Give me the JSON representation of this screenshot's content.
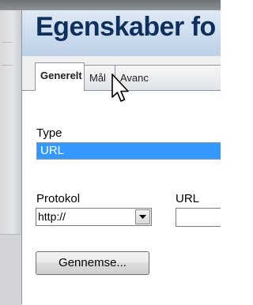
{
  "dialog": {
    "title": "Egenskaber fo",
    "tabs": [
      {
        "label": "Generelt",
        "active": true
      },
      {
        "label": "Mål",
        "active": false
      },
      {
        "label": "Avanc",
        "active": false
      }
    ]
  },
  "fields": {
    "type_label": "Type",
    "type_value": "URL",
    "protocol_label": "Protokol",
    "protocol_value": "http://",
    "url_label": "URL",
    "url_value": ""
  },
  "buttons": {
    "browse_label": "Gennemse..."
  },
  "colors": {
    "title": "#0f2f5d",
    "selection": "#3399ff",
    "header": "#ccdcee"
  }
}
